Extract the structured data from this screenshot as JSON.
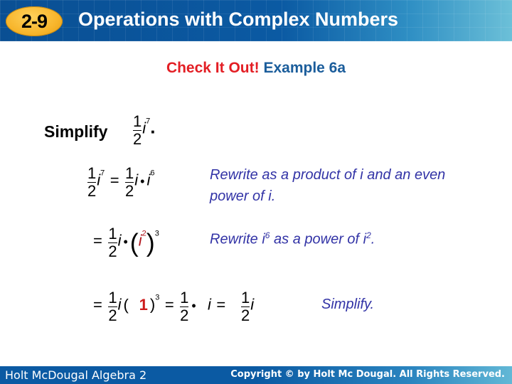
{
  "header": {
    "lesson_badge": "2-9",
    "title": "Operations with Complex Numbers",
    "colors": {
      "badge": "#f7b52b",
      "bar": "#0b5aa3"
    }
  },
  "subheading": {
    "label_red": "Check It Out!",
    "label_blue": "Example 6a"
  },
  "problem": {
    "prompt": "Simplify",
    "expr": {
      "num": "1",
      "den": "2",
      "var": "i",
      "exp": "7",
      "end": "."
    }
  },
  "steps": [
    {
      "lhs": {
        "num": "1",
        "den": "2",
        "var": "i",
        "exp": "7"
      },
      "eq": "=",
      "rhs": {
        "num": "1",
        "den": "2",
        "var": "i",
        "dot": "•",
        "var2": "i",
        "exp2": "6"
      },
      "note": "Rewrite as a product of i and an even power of i."
    },
    {
      "eq": "=",
      "rhs": {
        "num": "1",
        "den": "2",
        "var": "i",
        "dot": "•",
        "open": "(",
        "inner_var": "i",
        "inner_exp": "2",
        "close": ")",
        "outer_exp": "3"
      },
      "note_parts": {
        "a": "Rewrite i",
        "sup": "6",
        "b": " as a power of i",
        "sup2": "2",
        "c": "."
      }
    },
    {
      "eq": "=",
      "rhs1": {
        "num": "1",
        "den": "2",
        "var": "i",
        "open": "(",
        "inner": "1",
        "close": ")",
        "exp": "3"
      },
      "eq2": "=",
      "rhs2": {
        "num": "1",
        "den": "2",
        "dot": "•",
        "var": "i"
      },
      "eq3": "=",
      "rhs3": {
        "num": "1",
        "den": "2",
        "var": "i"
      },
      "note": "Simplify."
    }
  ],
  "footer": {
    "left": "Holt McDougal Algebra 2",
    "right": "Copyright © by Holt Mc Dougal. All Rights Reserved."
  }
}
